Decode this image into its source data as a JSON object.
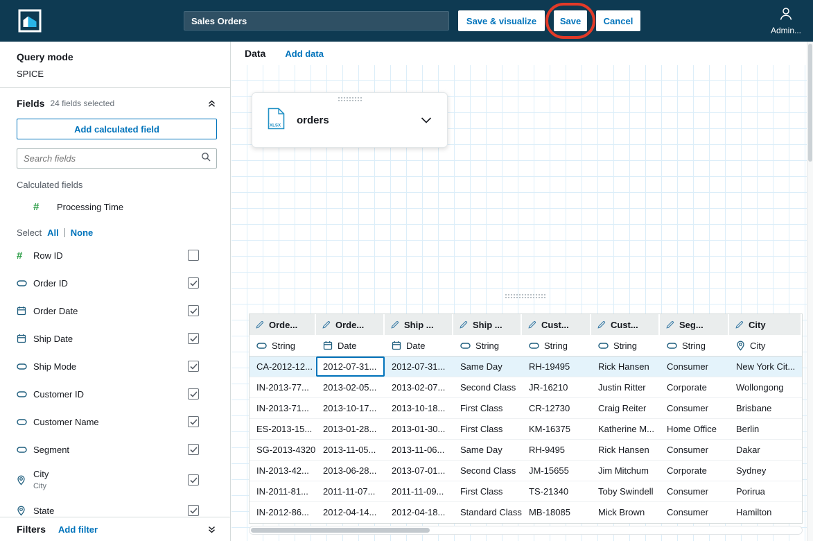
{
  "topbar": {
    "dataset_name": "Sales Orders",
    "buttons": {
      "save_visualize": "Save & visualize",
      "save": "Save",
      "cancel": "Cancel"
    },
    "user": "Admin..."
  },
  "sidebar": {
    "query_mode_label": "Query mode",
    "query_mode_value": "SPICE",
    "fields_label": "Fields",
    "fields_count": "24 fields selected",
    "add_calculated_field": "Add calculated field",
    "search_placeholder": "Search fields",
    "calculated_fields_label": "Calculated fields",
    "calculated_fields": [
      {
        "name": "Processing Time",
        "type": "numeric"
      }
    ],
    "select_label": "Select",
    "select_all": "All",
    "select_none": "None",
    "fields": [
      {
        "name": "Row ID",
        "type": "numeric",
        "checked": false
      },
      {
        "name": "Order ID",
        "type": "string",
        "checked": true
      },
      {
        "name": "Order Date",
        "type": "date",
        "checked": true
      },
      {
        "name": "Ship Date",
        "type": "date",
        "checked": true
      },
      {
        "name": "Ship Mode",
        "type": "string",
        "checked": true
      },
      {
        "name": "Customer ID",
        "type": "string",
        "checked": true
      },
      {
        "name": "Customer Name",
        "type": "string",
        "checked": true
      },
      {
        "name": "Segment",
        "type": "string",
        "checked": true
      },
      {
        "name": "City",
        "sub": "City",
        "type": "geo",
        "checked": true
      },
      {
        "name": "State",
        "type": "geo",
        "checked": true
      }
    ],
    "filters_label": "Filters",
    "add_filter": "Add filter"
  },
  "main": {
    "data_tab": "Data",
    "add_data": "Add data",
    "source_card": {
      "name": "orders",
      "file_type": "XLSX"
    }
  },
  "table": {
    "columns": [
      {
        "header": "Orde...",
        "type": "String",
        "type_kind": "string"
      },
      {
        "header": "Orde...",
        "type": "Date",
        "type_kind": "date"
      },
      {
        "header": "Ship ...",
        "type": "Date",
        "type_kind": "date"
      },
      {
        "header": "Ship ...",
        "type": "String",
        "type_kind": "string"
      },
      {
        "header": "Cust...",
        "type": "String",
        "type_kind": "string"
      },
      {
        "header": "Cust...",
        "type": "String",
        "type_kind": "string"
      },
      {
        "header": "Seg...",
        "type": "String",
        "type_kind": "string"
      },
      {
        "header": "City",
        "type": "City",
        "type_kind": "geo"
      }
    ],
    "selected_cell": {
      "row": 0,
      "col": 1
    },
    "rows": [
      [
        "CA-2012-12...",
        "2012-07-31...",
        "2012-07-31...",
        "Same Day",
        "RH-19495",
        "Rick Hansen",
        "Consumer",
        "New York Cit..."
      ],
      [
        "IN-2013-77...",
        "2013-02-05...",
        "2013-02-07...",
        "Second Class",
        "JR-16210",
        "Justin Ritter",
        "Corporate",
        "Wollongong"
      ],
      [
        "IN-2013-71...",
        "2013-10-17...",
        "2013-10-18...",
        "First Class",
        "CR-12730",
        "Craig Reiter",
        "Consumer",
        "Brisbane"
      ],
      [
        "ES-2013-15...",
        "2013-01-28...",
        "2013-01-30...",
        "First Class",
        "KM-16375",
        "Katherine M...",
        "Home Office",
        "Berlin"
      ],
      [
        "SG-2013-4320",
        "2013-11-05...",
        "2013-11-06...",
        "Same Day",
        "RH-9495",
        "Rick Hansen",
        "Consumer",
        "Dakar"
      ],
      [
        "IN-2013-42...",
        "2013-06-28...",
        "2013-07-01...",
        "Second Class",
        "JM-15655",
        "Jim Mitchum",
        "Corporate",
        "Sydney"
      ],
      [
        "IN-2011-81...",
        "2011-11-07...",
        "2011-11-09...",
        "First Class",
        "TS-21340",
        "Toby Swindell",
        "Consumer",
        "Porirua"
      ],
      [
        "IN-2012-86...",
        "2012-04-14...",
        "2012-04-18...",
        "Standard Class",
        "MB-18085",
        "Mick Brown",
        "Consumer",
        "Hamilton"
      ]
    ]
  },
  "colors": {
    "accent": "#0073BB",
    "topbar_bg": "#0E3A52",
    "annotation_red": "#E23A28",
    "grid_line": "#DCEEF9",
    "row_highlight": "#E4F3FB",
    "numeric_green": "#2E9E48",
    "field_icon": "#1F5E7E",
    "xlsx_blue": "#2492C6"
  }
}
